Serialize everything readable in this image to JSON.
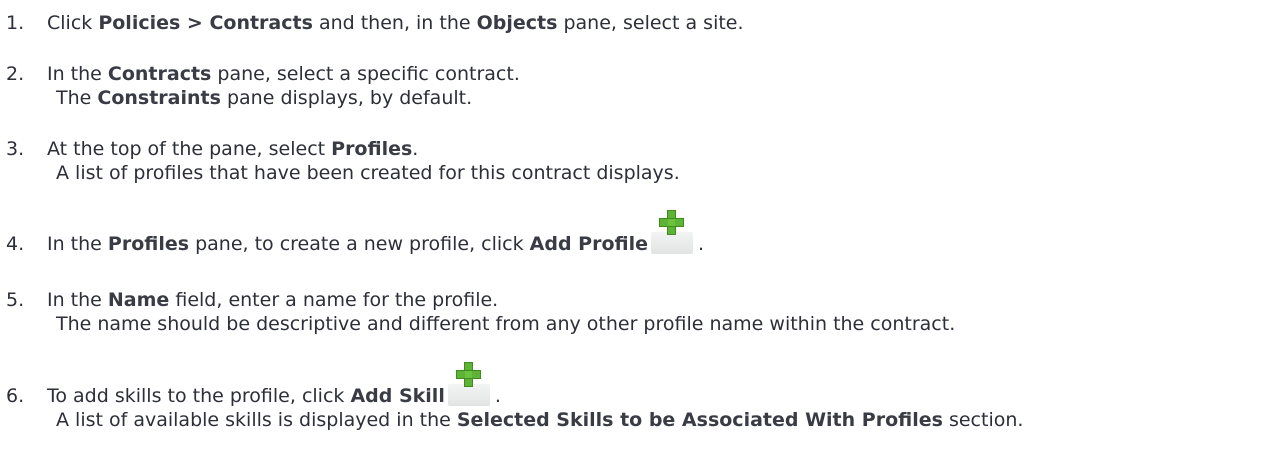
{
  "steps": [
    {
      "num": "1.",
      "parts": [
        "Click ",
        "Policies > Contracts",
        " and then, in the ",
        "Objects",
        " pane, select a site."
      ]
    },
    {
      "num": "2.",
      "parts": [
        "In the ",
        "Contracts",
        " pane, select a specific contract."
      ],
      "sub": [
        "The ",
        "Constraints",
        " pane displays, by default."
      ]
    },
    {
      "num": "3.",
      "parts": [
        "At the top of the pane, select ",
        "Profiles",
        "."
      ],
      "sub": [
        "A list of profiles that have been created for this contract displays."
      ]
    },
    {
      "num": "4.",
      "parts": [
        "In the ",
        "Profiles",
        " pane, to create a new profile, click ",
        "Add Profile",
        "."
      ]
    },
    {
      "num": "5.",
      "parts": [
        "In the ",
        "Name",
        " field, enter a name for the profile."
      ],
      "sub": [
        "The name should be descriptive and different from any other profile name within the contract."
      ]
    },
    {
      "num": "6.",
      "parts": [
        "To add skills to the profile, click ",
        "Add Skill",
        "."
      ],
      "sub": [
        "A list of available skills is displayed in the ",
        "Selected Skills to be Associated With Profiles",
        " section."
      ]
    }
  ],
  "icons": {
    "add_profile": "green-plus-icon",
    "add_skill": "green-plus-icon"
  }
}
